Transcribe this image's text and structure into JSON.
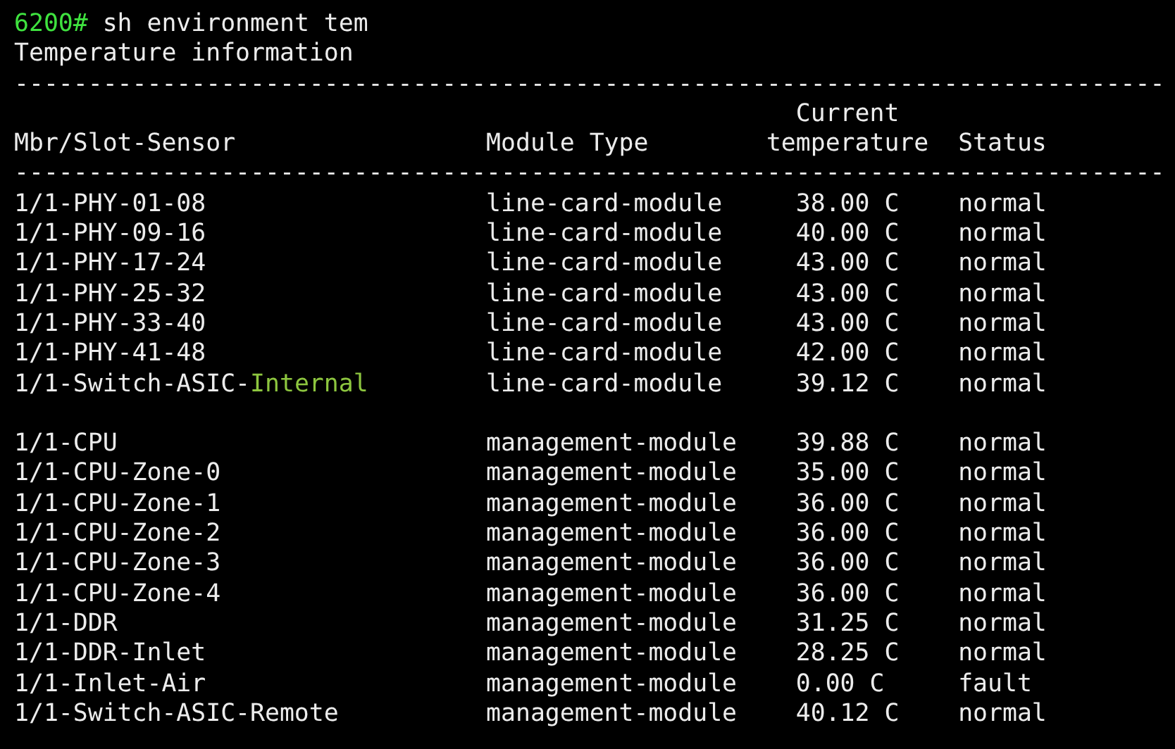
{
  "prompt": "6200#",
  "command": "sh environment tem",
  "title": "Temperature information",
  "separator": "------------------------------------------------------------------------------",
  "columns": [
    {
      "label": "Mbr/Slot-Sensor"
    },
    {
      "label": "Module Type"
    },
    {
      "label": "Current temperature"
    },
    {
      "label": "Status"
    }
  ],
  "groups": [
    {
      "rows": [
        {
          "sensor": "1/1-PHY-01-08",
          "module_type": "line-card-module",
          "temperature": "38.00 C",
          "status": "normal"
        },
        {
          "sensor": "1/1-PHY-09-16",
          "module_type": "line-card-module",
          "temperature": "40.00 C",
          "status": "normal"
        },
        {
          "sensor": "1/1-PHY-17-24",
          "module_type": "line-card-module",
          "temperature": "43.00 C",
          "status": "normal"
        },
        {
          "sensor": "1/1-PHY-25-32",
          "module_type": "line-card-module",
          "temperature": "43.00 C",
          "status": "normal"
        },
        {
          "sensor": "1/1-PHY-33-40",
          "module_type": "line-card-module",
          "temperature": "43.00 C",
          "status": "normal"
        },
        {
          "sensor": "1/1-PHY-41-48",
          "module_type": "line-card-module",
          "temperature": "42.00 C",
          "status": "normal"
        },
        {
          "sensor": "1/1-Switch-ASIC-",
          "sensor_highlight": "Internal",
          "module_type": "line-card-module",
          "temperature": "39.12 C",
          "status": "normal"
        }
      ]
    },
    {
      "rows": [
        {
          "sensor": "1/1-CPU",
          "module_type": "management-module",
          "temperature": "39.88 C",
          "status": "normal"
        },
        {
          "sensor": "1/1-CPU-Zone-0",
          "module_type": "management-module",
          "temperature": "35.00 C",
          "status": "normal"
        },
        {
          "sensor": "1/1-CPU-Zone-1",
          "module_type": "management-module",
          "temperature": "36.00 C",
          "status": "normal"
        },
        {
          "sensor": "1/1-CPU-Zone-2",
          "module_type": "management-module",
          "temperature": "36.00 C",
          "status": "normal"
        },
        {
          "sensor": "1/1-CPU-Zone-3",
          "module_type": "management-module",
          "temperature": "36.00 C",
          "status": "normal"
        },
        {
          "sensor": "1/1-CPU-Zone-4",
          "module_type": "management-module",
          "temperature": "36.00 C",
          "status": "normal"
        },
        {
          "sensor": "1/1-DDR",
          "module_type": "management-module",
          "temperature": "31.25 C",
          "status": "normal"
        },
        {
          "sensor": "1/1-DDR-Inlet",
          "module_type": "management-module",
          "temperature": "28.25 C",
          "status": "normal"
        },
        {
          "sensor": "1/1-Inlet-Air",
          "module_type": "management-module",
          "temperature": "0.00 C",
          "status": "fault"
        },
        {
          "sensor": "1/1-Switch-ASIC-Remote",
          "module_type": "management-module",
          "temperature": "40.12 C",
          "status": "normal"
        }
      ]
    }
  ]
}
